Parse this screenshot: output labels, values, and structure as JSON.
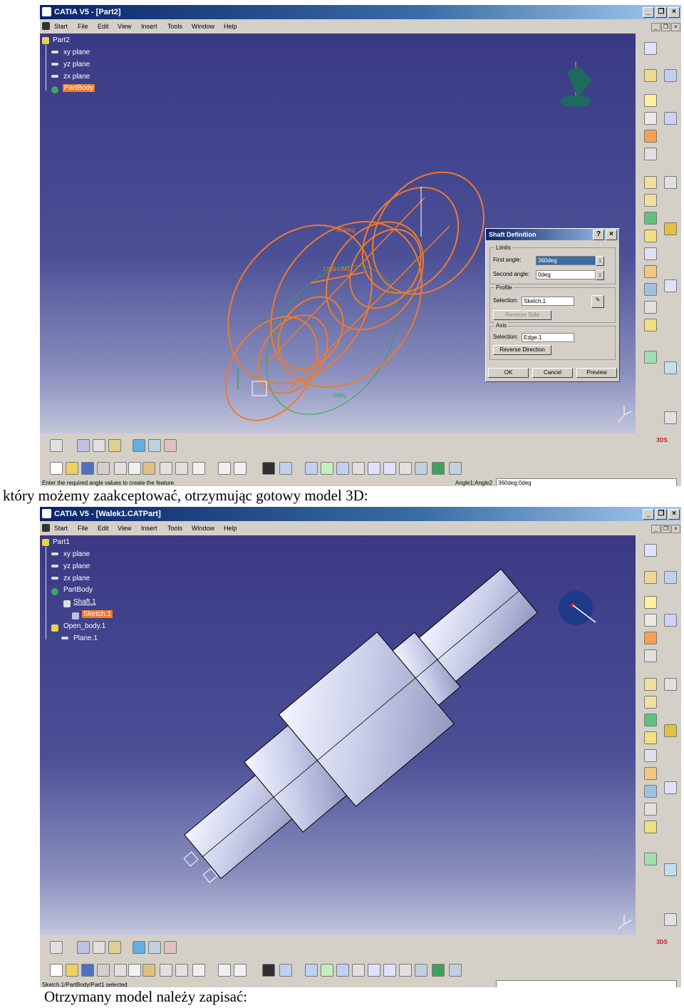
{
  "captions": {
    "middle": "który możemy zaakceptować, otrzymując gotowy model 3D:",
    "bottom": "Otrzymany model należy zapisać:"
  },
  "menu": [
    "Start",
    "File",
    "Edit",
    "View",
    "Insert",
    "Tools",
    "Window",
    "Help"
  ],
  "window1": {
    "title": "CATIA V5 - [Part2]",
    "tree": {
      "root": "Part2",
      "items": [
        "xy plane",
        "yz plane",
        "zx plane",
        "PartBody"
      ]
    },
    "dimensions": [
      "360deg",
      "0deg",
      "LIM2 LIM1"
    ],
    "dialog": {
      "title": "Shaft Definition",
      "limits_label": "Limits",
      "first_angle_label": "First angle:",
      "first_angle_value": "360deg",
      "second_angle_label": "Second angle:",
      "second_angle_value": "0deg",
      "profile_label": "Profile",
      "selection_label": "Selection:",
      "profile_selection_value": "Sketch.1",
      "reverse_side_label": "Reverse Side",
      "axis_label": "Axis",
      "axis_selection_value": "Edge.1",
      "reverse_direction_label": "Reverse Direction",
      "ok_label": "OK",
      "cancel_label": "Cancel",
      "preview_label": "Preview"
    },
    "status_text": "Enter the required angle values to create the feature.",
    "status_field_label": "Angle1;Angle2",
    "status_field_value": "360deg;0deg"
  },
  "window2": {
    "title": "CATIA V5 - [Walek1.CATPart]",
    "tree": {
      "root": "Part1",
      "items": [
        "xy plane",
        "yz plane",
        "zx plane",
        "PartBody",
        "Shaft.1",
        "Sketch.1",
        "Open_body.1",
        "Plane.1"
      ]
    },
    "status_text": "Sketch.1/PartBody/Part1 selected"
  },
  "colors": {
    "title_bar": "#0a246a",
    "sketch_orange": "#f07a2a",
    "axis_green": "#2ea84a",
    "viewport_top": "#3a3a84",
    "part_surface": "#d8dcf0"
  }
}
